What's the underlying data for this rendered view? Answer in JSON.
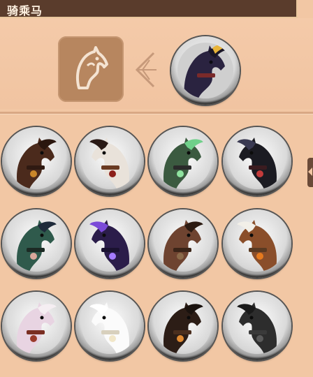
{
  "header": {
    "title": "骑乘马"
  },
  "selected": {
    "name": "dark-horse-gold-plume",
    "body": "#2a2340",
    "mane": "#1a1626",
    "accent": "#e8b43a",
    "tack": "#7a2a2a"
  },
  "mounts": [
    {
      "id": "brown-gold-armor",
      "body": "#4b2a1c",
      "mane": "#2a160e",
      "accent": "#c9862a",
      "tack": "#2f1a12",
      "row": 0,
      "col": 0
    },
    {
      "id": "white-red-plume",
      "body": "#e9e2da",
      "mane": "#2a1a16",
      "accent": "#8c1f1a",
      "tack": "#6a3a22",
      "row": 0,
      "col": 1
    },
    {
      "id": "green-spectral",
      "body": "#3b5a40",
      "mane": "#6fd08a",
      "accent": "#8fe39f",
      "tack": "#2a2a2a",
      "row": 0,
      "col": 2
    },
    {
      "id": "black-feathered",
      "body": "#1b1b22",
      "mane": "#3a3a52",
      "accent": "#c23b3b",
      "tack": "#3b1c20",
      "row": 0,
      "col": 3
    },
    {
      "id": "teal-dragon",
      "body": "#2f5a4c",
      "mane": "#1e2a3a",
      "accent": "#d9a79a",
      "tack": "#1c2a24",
      "row": 1,
      "col": 0
    },
    {
      "id": "violet-shadow",
      "body": "#2b1d4a",
      "mane": "#7b4bd8",
      "accent": "#a57cff",
      "tack": "#1a1230",
      "row": 1,
      "col": 1
    },
    {
      "id": "plain-bay",
      "body": "#6e4330",
      "mane": "#2b1a12",
      "accent": "#8a6a4a",
      "tack": "#3a2418",
      "row": 1,
      "col": 2
    },
    {
      "id": "chestnut-flame",
      "body": "#8a4e2a",
      "mane": "#f2efe8",
      "accent": "#e57a1e",
      "tack": "#5a3a22",
      "row": 1,
      "col": 3
    },
    {
      "id": "pink-white-tack",
      "body": "#e8d4e2",
      "mane": "#f5eef2",
      "accent": "#9a3a2a",
      "tack": "#7a2e22",
      "row": 2,
      "col": 0
    },
    {
      "id": "white-glow",
      "body": "#fbfbfb",
      "mane": "#ffffff",
      "accent": "#f1e6c8",
      "tack": "#d8d0bd",
      "row": 2,
      "col": 1
    },
    {
      "id": "dark-orange-armor",
      "body": "#2c1d16",
      "mane": "#1a120e",
      "accent": "#e08a32",
      "tack": "#4a2e1e",
      "row": 2,
      "col": 2
    },
    {
      "id": "shadow-grey",
      "body": "#2d2d2d",
      "mane": "#1a1a1a",
      "accent": "#5a5a5a",
      "tack": "#3a3a3a",
      "row": 2,
      "col": 3
    }
  ]
}
